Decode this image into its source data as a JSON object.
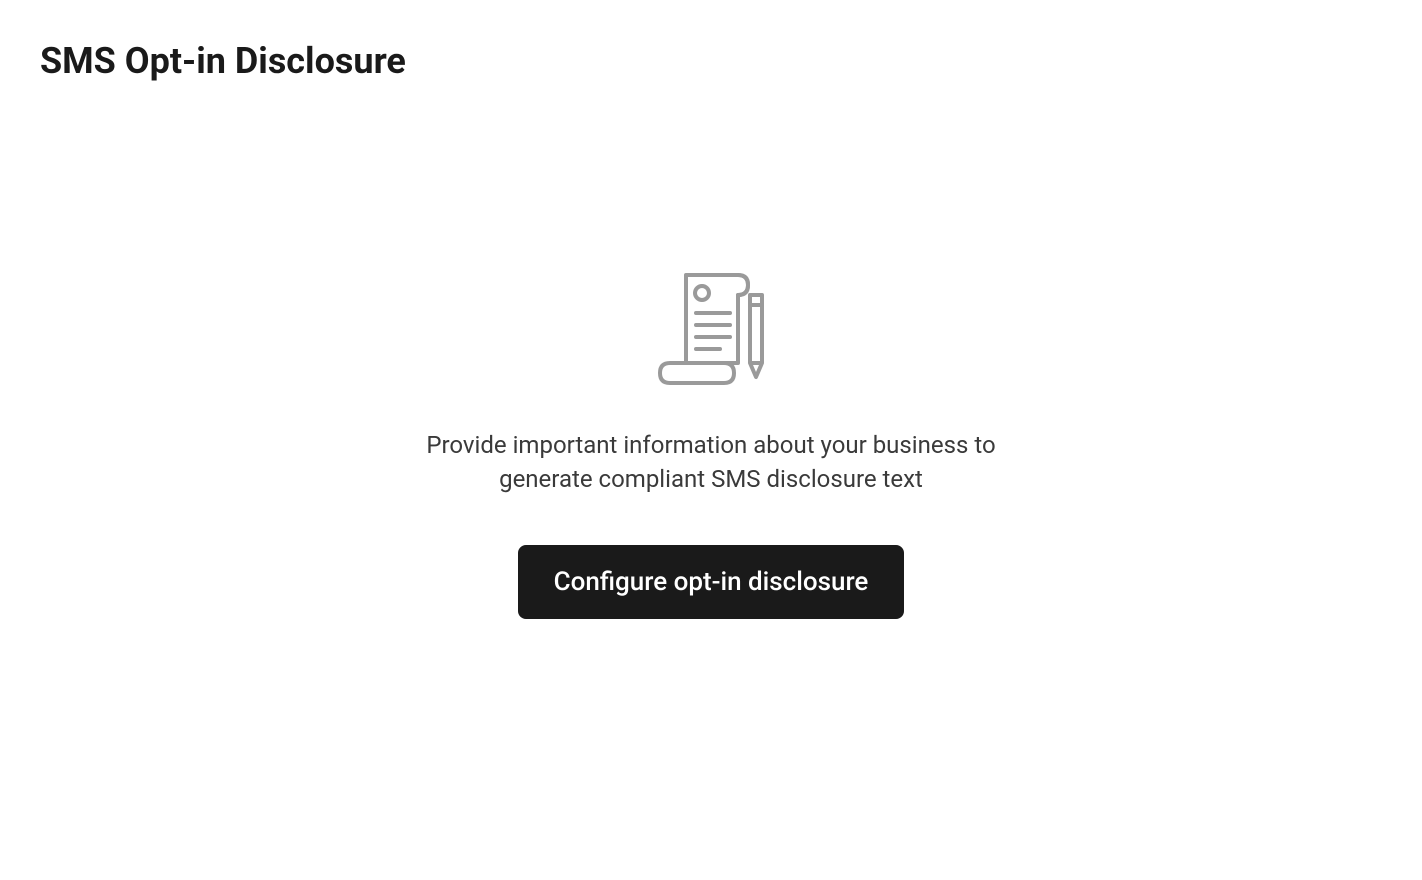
{
  "header": {
    "title": "SMS Opt-in Disclosure"
  },
  "emptyState": {
    "description": "Provide important information about your business to generate compliant SMS disclosure text",
    "ctaLabel": "Configure opt-in disclosure"
  }
}
